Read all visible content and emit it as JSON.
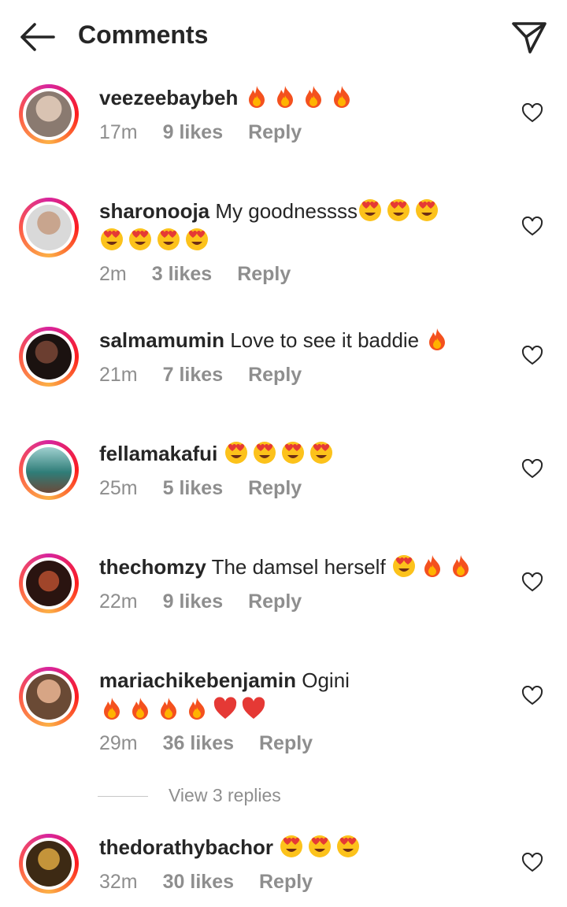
{
  "header": {
    "title": "Comments",
    "back_icon": "arrow-left-icon",
    "share_icon": "paper-plane-icon"
  },
  "colors": {
    "text": "#262626",
    "secondary": "#8e8e8e",
    "story_ring_start": "#d6249f",
    "story_ring_end": "#fcb045"
  },
  "comments": [
    {
      "username": "veezeebaybeh",
      "text": "",
      "emojis": [
        "fire",
        "fire",
        "fire",
        "fire"
      ],
      "time": "17m",
      "likes": "9 likes",
      "reply": "Reply",
      "avatar": "#9a8f88"
    },
    {
      "username": "sharonooja",
      "text": "My goodnessss",
      "emojis": [
        "heart-eyes",
        "heart-eyes",
        "heart-eyes",
        "heart-eyes",
        "heart-eyes",
        "heart-eyes",
        "heart-eyes"
      ],
      "time": "2m",
      "likes": "3 likes",
      "reply": "Reply",
      "avatar": "#b99a86"
    },
    {
      "username": "salmamumin",
      "text": "Love to see it baddie",
      "emojis": [
        "fire"
      ],
      "time": "21m",
      "likes": "7 likes",
      "reply": "Reply",
      "avatar": "#2a1a18"
    },
    {
      "username": "fellamakafui",
      "text": "",
      "emojis": [
        "heart-eyes",
        "heart-eyes",
        "heart-eyes",
        "heart-eyes"
      ],
      "time": "25m",
      "likes": "5 likes",
      "reply": "Reply",
      "avatar": "#4f8e86"
    },
    {
      "username": "thechomzy",
      "text": "The damsel herself",
      "emojis": [
        "heart-eyes",
        "fire",
        "fire"
      ],
      "time": "22m",
      "likes": "9 likes",
      "reply": "Reply",
      "avatar": "#5a2a1e"
    },
    {
      "username": "mariachikebenjamin",
      "text": "Ogini",
      "emojis": [
        "fire",
        "fire",
        "fire",
        "fire",
        "red-heart",
        "red-heart"
      ],
      "time": "29m",
      "likes": "36 likes",
      "reply": "Reply",
      "avatar": "#c4957a"
    },
    {
      "username": "thedorathybachor",
      "text": "",
      "emojis": [
        "heart-eyes",
        "heart-eyes",
        "heart-eyes"
      ],
      "time": "32m",
      "likes": "30 likes",
      "reply": "Reply",
      "avatar": "#5b3a20"
    }
  ],
  "view_replies": "View 3 replies",
  "like_icon": "heart-outline-icon"
}
